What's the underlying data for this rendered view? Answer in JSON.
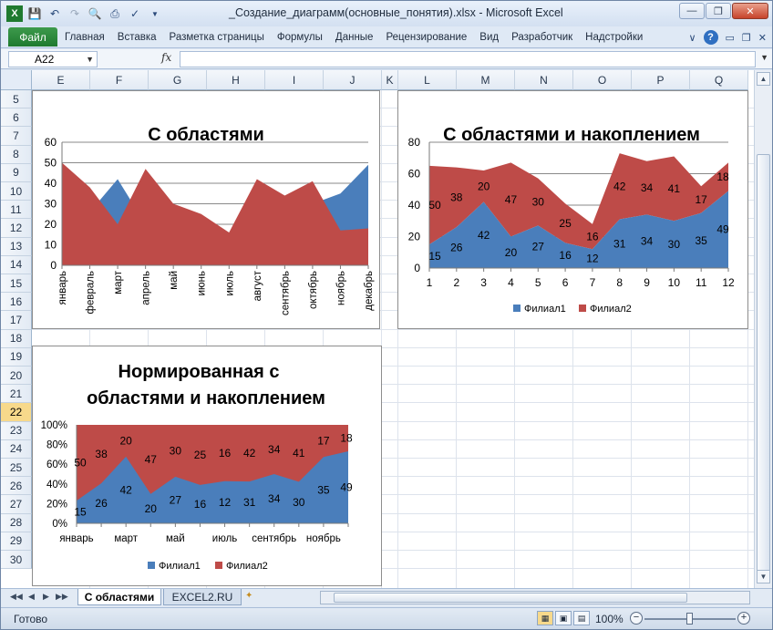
{
  "window": {
    "title": "_Создание_диаграмм(основные_понятия).xlsx - Microsoft Excel",
    "qat_icons": [
      "excel-logo-icon",
      "save-icon",
      "undo-icon",
      "redo-icon",
      "print-preview-icon",
      "print-icon",
      "spellcheck-icon"
    ]
  },
  "ribbon": {
    "file_tab": "Файл",
    "tabs": [
      "Главная",
      "Вставка",
      "Разметка страницы",
      "Формулы",
      "Данные",
      "Рецензирование",
      "Вид",
      "Разработчик",
      "Надстройки"
    ]
  },
  "formula_bar": {
    "name_box": "A22",
    "fx_label": "fx",
    "value": ""
  },
  "grid": {
    "columns": [
      "E",
      "F",
      "G",
      "H",
      "I",
      "J",
      "K",
      "L",
      "M",
      "N",
      "O",
      "P",
      "Q"
    ],
    "rows": [
      "5",
      "6",
      "7",
      "8",
      "9",
      "10",
      "11",
      "12",
      "13",
      "14",
      "15",
      "16",
      "17",
      "18",
      "19",
      "20",
      "21",
      "22",
      "23",
      "24",
      "25",
      "26",
      "27",
      "28",
      "29",
      "30"
    ],
    "selected_row": "22"
  },
  "sheets": {
    "active": "С областями",
    "other": "EXCEL2.RU"
  },
  "status": {
    "text": "Готово",
    "zoom": "100%"
  },
  "chart_data": [
    {
      "type": "area",
      "title": "С областями",
      "categories": [
        "январь",
        "февраль",
        "март",
        "апрель",
        "май",
        "июнь",
        "июль",
        "август",
        "сентябрь",
        "октябрь",
        "ноябрь",
        "декабрь"
      ],
      "series": [
        {
          "values": [
            15,
            26,
            42,
            20,
            27,
            16,
            12,
            31,
            34,
            30,
            35,
            49
          ],
          "color": "#4a7ebb"
        },
        {
          "values": [
            50,
            38,
            20,
            47,
            30,
            25,
            16,
            42,
            34,
            41,
            17,
            18
          ],
          "color": "#be4b48"
        }
      ],
      "ylim": [
        0,
        60
      ],
      "yticks": [
        0,
        10,
        20,
        30,
        40,
        50,
        60
      ],
      "grid": true
    },
    {
      "type": "area",
      "stacked": true,
      "title": "С областями и накоплением",
      "categories": [
        "1",
        "2",
        "3",
        "4",
        "5",
        "6",
        "7",
        "8",
        "9",
        "10",
        "11",
        "12"
      ],
      "series": [
        {
          "name": "Филиал1",
          "values": [
            15,
            26,
            42,
            20,
            27,
            16,
            12,
            31,
            34,
            30,
            35,
            49
          ],
          "color": "#4a7ebb"
        },
        {
          "name": "Филиал2",
          "values": [
            50,
            38,
            20,
            47,
            30,
            25,
            16,
            42,
            34,
            41,
            17,
            18
          ],
          "color": "#be4b48"
        }
      ],
      "ylim": [
        0,
        80
      ],
      "yticks": [
        0,
        20,
        40,
        60,
        80
      ],
      "legend": "bottom"
    },
    {
      "type": "area",
      "stacked": "percent",
      "title": "Нормированная с областями и накоплением",
      "title_lines": [
        "Нормированная с",
        "областями и накоплением"
      ],
      "categories": [
        "январь",
        "",
        "март",
        "",
        "май",
        "",
        "июль",
        "",
        "сентябрь",
        "",
        "ноябрь",
        ""
      ],
      "series": [
        {
          "name": "Филиал1",
          "values": [
            15,
            26,
            42,
            20,
            27,
            16,
            12,
            31,
            34,
            30,
            35,
            49
          ],
          "color": "#4a7ebb"
        },
        {
          "name": "Филиал2",
          "values": [
            50,
            38,
            20,
            47,
            30,
            25,
            16,
            42,
            34,
            41,
            17,
            18
          ],
          "color": "#be4b48"
        }
      ],
      "ylim": [
        0,
        100
      ],
      "yticks": [
        "0%",
        "20%",
        "40%",
        "60%",
        "80%",
        "100%"
      ],
      "legend": "bottom"
    }
  ]
}
